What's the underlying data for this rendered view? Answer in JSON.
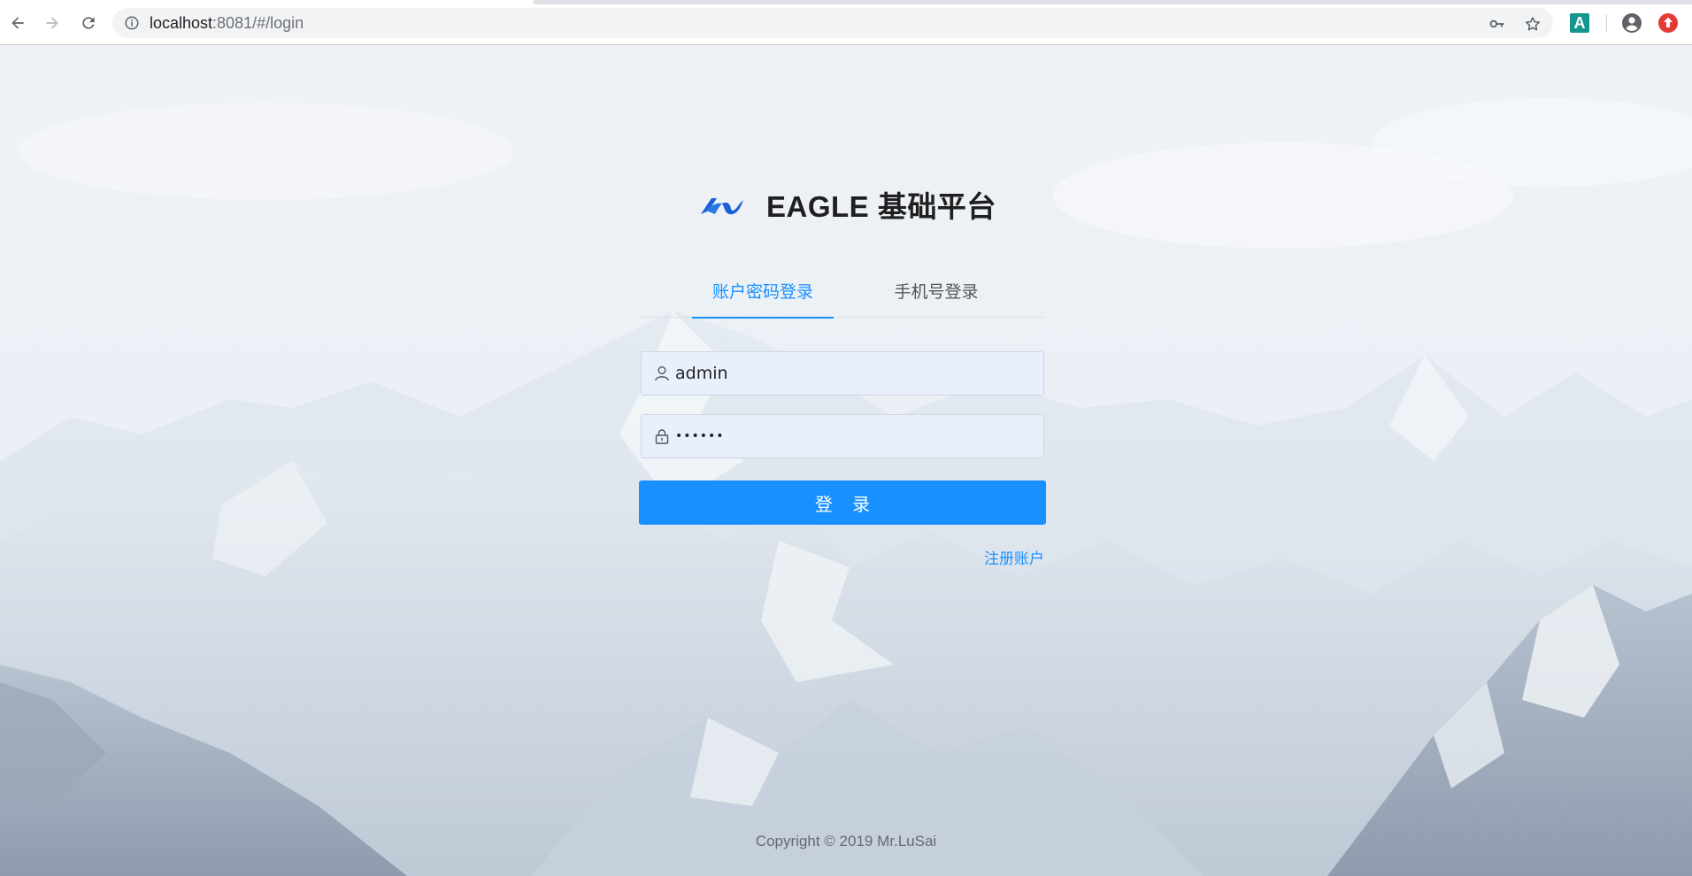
{
  "browser": {
    "url_host": "localhost",
    "url_path": ":8081/#/login",
    "icons": {
      "back": "arrow-left-icon",
      "forward": "arrow-right-icon",
      "reload": "reload-icon",
      "site_info": "info-icon",
      "password_key": "key-icon",
      "bookmark": "star-icon",
      "extension": "translate-extension-icon",
      "profile": "account-circle-icon",
      "update": "update-icon"
    },
    "extension_letter": "A"
  },
  "brand": {
    "title": "EAGLE 基础平台",
    "accent": "#1a5fd6"
  },
  "login": {
    "tabs": [
      {
        "label": "账户密码登录",
        "active": true
      },
      {
        "label": "手机号登录",
        "active": false
      }
    ],
    "username": {
      "value": "admin",
      "icon": "user-icon"
    },
    "password": {
      "value": "••••••",
      "icon": "lock-icon"
    },
    "submit_label": "登 录",
    "register_label": "注册账户",
    "accent": "#1890ff"
  },
  "footer": {
    "copyright": "Copyright © 2019 Mr.LuSai"
  }
}
